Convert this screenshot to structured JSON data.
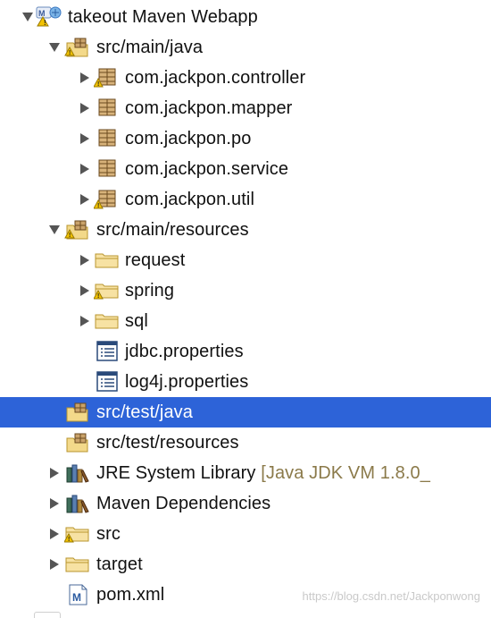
{
  "tree": {
    "root": {
      "label": "takeout Maven Webapp",
      "icon": "maven-project-icon"
    },
    "src_main_java": {
      "label": "src/main/java",
      "icon": "source-folder-icon",
      "children": [
        {
          "label": "com.jackpon.controller",
          "icon": "package-icon"
        },
        {
          "label": "com.jackpon.mapper",
          "icon": "package-icon"
        },
        {
          "label": "com.jackpon.po",
          "icon": "package-icon"
        },
        {
          "label": "com.jackpon.service",
          "icon": "package-icon"
        },
        {
          "label": "com.jackpon.util",
          "icon": "package-icon"
        }
      ]
    },
    "src_main_resources": {
      "label": "src/main/resources",
      "icon": "source-folder-icon",
      "children": [
        {
          "label": "request",
          "icon": "folder-icon"
        },
        {
          "label": "spring",
          "icon": "folder-icon"
        },
        {
          "label": "sql",
          "icon": "folder-icon"
        },
        {
          "label": "jdbc.properties",
          "icon": "properties-file-icon"
        },
        {
          "label": "log4j.properties",
          "icon": "properties-file-icon"
        }
      ]
    },
    "src_test_java": {
      "label": "src/test/java",
      "icon": "source-folder-icon",
      "selected": true
    },
    "src_test_resources": {
      "label": "src/test/resources",
      "icon": "source-folder-icon"
    },
    "jre": {
      "label": "JRE System Library",
      "decoration": "[Java JDK VM 1.8.0_",
      "icon": "library-icon"
    },
    "maven_deps": {
      "label": "Maven Dependencies",
      "icon": "library-icon"
    },
    "src": {
      "label": "src",
      "icon": "folder-icon"
    },
    "target": {
      "label": "target",
      "icon": "folder-icon"
    },
    "pom": {
      "label": "pom.xml",
      "icon": "maven-pom-icon"
    }
  },
  "watermark": "https://blog.csdn.net/Jackponwong",
  "colors": {
    "selection": "#2d63d8",
    "decoration_text": "#8b7a4a",
    "folder": "#e8c872",
    "package": "#a0783c"
  }
}
